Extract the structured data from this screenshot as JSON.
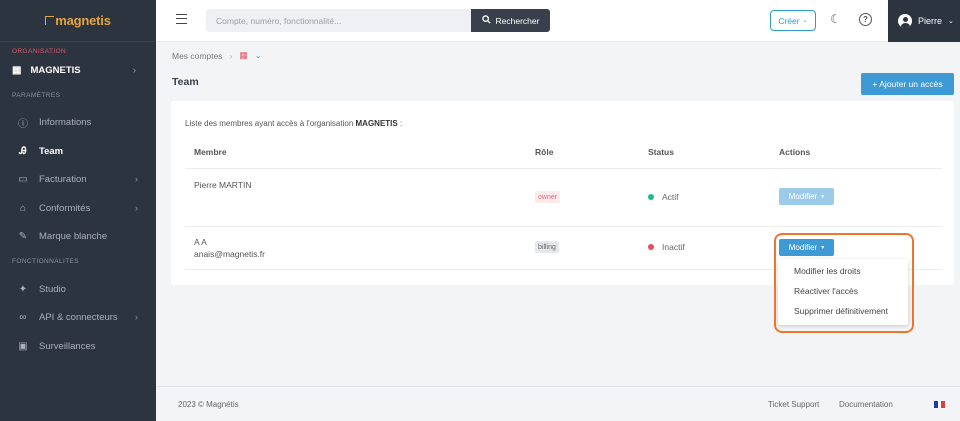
{
  "colors": {
    "sidebar_bg": "#2c3440",
    "accent": "#3d9ad5",
    "org_label": "#e0566a",
    "active_dot": "#1dbb8a",
    "inactive_dot": "#e84a5f",
    "highlight": "#f0732e"
  },
  "sidebar": {
    "logo": "magnetis",
    "org_section": "ORGANISATION",
    "org_name": "MAGNETIS",
    "params_section": "PARAMÈTRES",
    "items": [
      {
        "label": "Informations",
        "icon": "info-icon"
      },
      {
        "label": "Team",
        "icon": "team-icon"
      },
      {
        "label": "Facturation",
        "icon": "billing-icon"
      },
      {
        "label": "Conformités",
        "icon": "bank-icon"
      },
      {
        "label": "Marque blanche",
        "icon": "pen-icon"
      }
    ],
    "func_section": "FONCTIONNALITES",
    "func_items": [
      {
        "label": "Studio",
        "icon": "sparkle-icon"
      },
      {
        "label": "API & connecteurs",
        "icon": "link-icon"
      },
      {
        "label": "Surveillances",
        "icon": "monitor-icon"
      }
    ]
  },
  "topbar": {
    "search_placeholder": "Compte, numéro, fonctionnalité...",
    "search_button": "Rechercher",
    "create_button": "Créer",
    "user_name": "Pierre"
  },
  "breadcrumb": {
    "root": "Mes comptes"
  },
  "page": {
    "title": "Team",
    "add_button": "+ Ajouter un accès"
  },
  "card": {
    "intro_prefix": "Liste des membres ayant accès à l'organisation ",
    "intro_org": "MAGNETIS",
    "intro_suffix": " :",
    "headers": {
      "member": "Membre",
      "role": "Rôle",
      "status": "Status",
      "actions": "Actions"
    },
    "rows": [
      {
        "name": "Pierre MARTIN",
        "email": "",
        "role": "owner",
        "status": "Actif",
        "action": "Modifier"
      },
      {
        "name": "A A",
        "email": "anais@magnetis.fr",
        "role": "billing",
        "status": "Inactif",
        "action": "Modifier"
      }
    ]
  },
  "dropdown": {
    "items": [
      "Modifier les droits",
      "Réactiver l'accès",
      "Supprimer définitivement"
    ]
  },
  "footer": {
    "copyright": "2023 © Magnétis",
    "support": "Ticket Support",
    "docs": "Documentation"
  }
}
